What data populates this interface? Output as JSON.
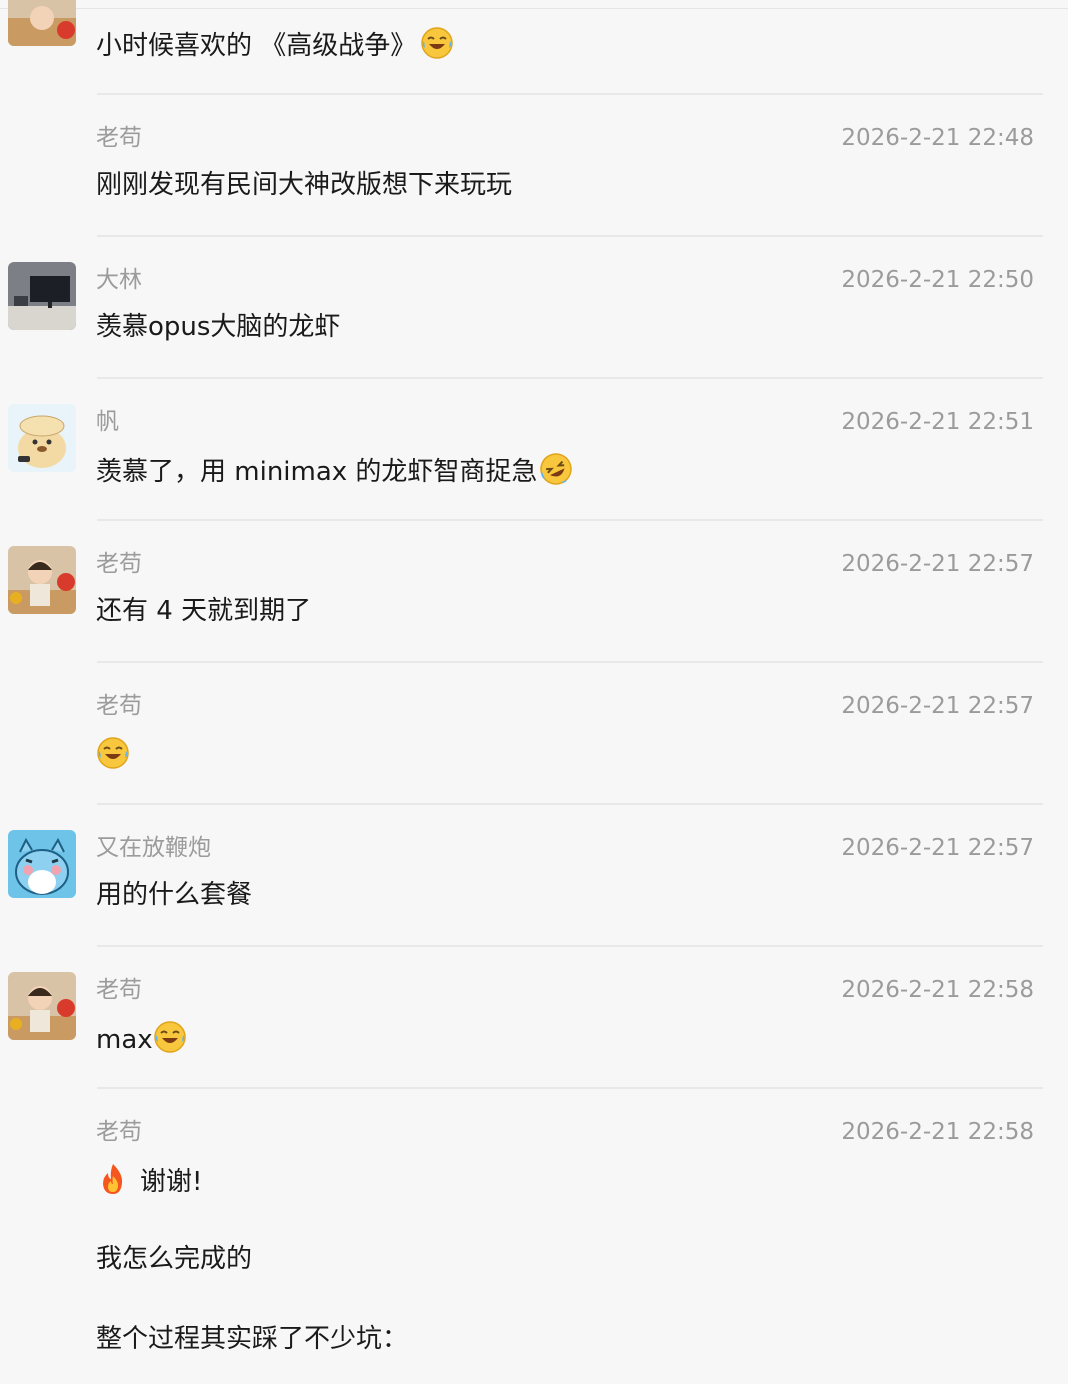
{
  "messages": [
    {
      "name": "",
      "time": "",
      "text": "小时候喜欢的 《高级战争》",
      "emoji": "laughing-tears-icon",
      "avatar": "girl-apple-avatar"
    },
    {
      "name": "老苟",
      "time": "2026-2-21 22:48",
      "text": "刚刚发现有民间大神改版想下来玩玩"
    },
    {
      "name": "大林",
      "time": "2026-2-21 22:50",
      "text": "羡慕opus大脑的龙虾",
      "avatar": "desk-monitor-avatar"
    },
    {
      "name": "帆",
      "time": "2026-2-21 22:51",
      "text": "羡慕了，用 minimax 的龙虾智商捉急",
      "emoji": "rolling-laugh-icon",
      "avatar": "cartoon-dog-avatar"
    },
    {
      "name": "老苟",
      "time": "2026-2-21 22:57",
      "text": "还有 4 天就到期了",
      "avatar": "girl-apple-avatar"
    },
    {
      "name": "老苟",
      "time": "2026-2-21 22:57",
      "text": "",
      "emoji": "laughing-tears-icon"
    },
    {
      "name": "又在放鞭炮",
      "time": "2026-2-21 22:57",
      "text": "用的什么套餐",
      "avatar": "blue-cat-avatar"
    },
    {
      "name": "老苟",
      "time": "2026-2-21 22:58",
      "text": "max",
      "emoji": "laughing-tears-icon",
      "avatar": "girl-apple-avatar"
    },
    {
      "name": "老苟",
      "time": "2026-2-21 22:58",
      "lead_emoji": "fire-icon",
      "text": "谢谢!",
      "extra": [
        "我怎么完成的",
        "整个过程其实踩了不少坑："
      ]
    }
  ]
}
